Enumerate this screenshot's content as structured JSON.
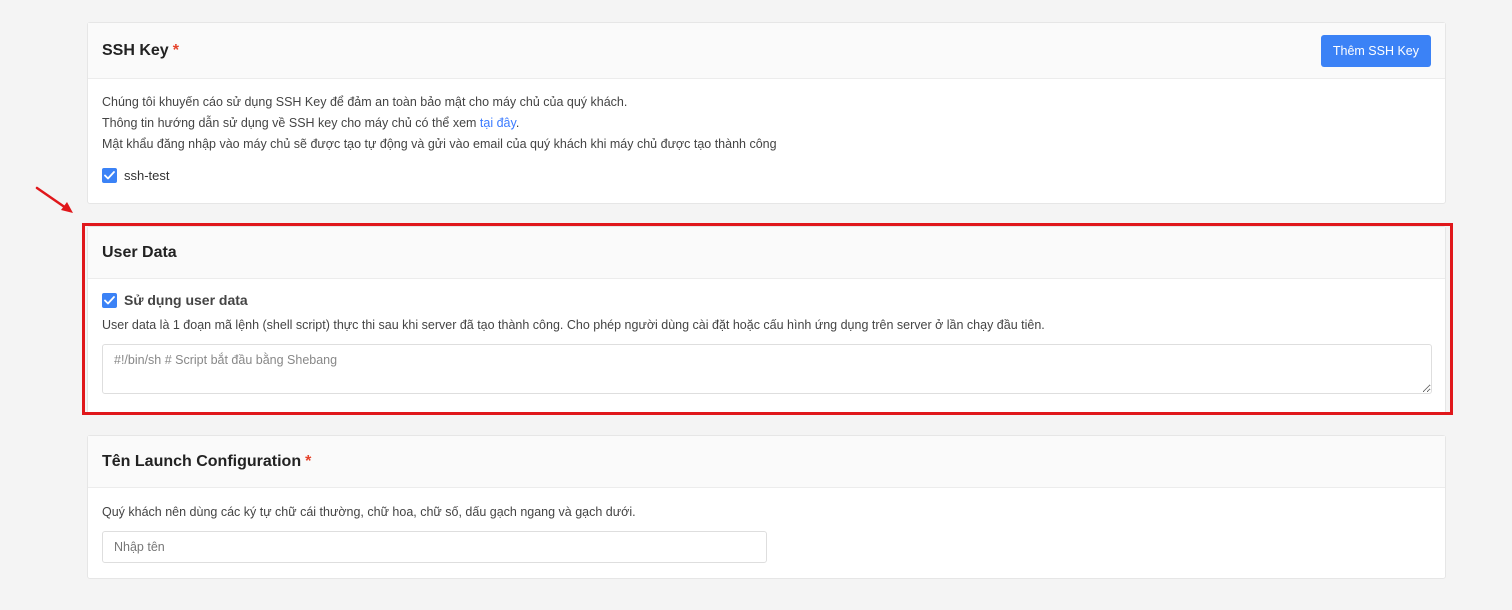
{
  "ssh_section": {
    "title": "SSH Key",
    "required_mark": "*",
    "add_button": "Thêm SSH Key",
    "line1": "Chúng tôi khuyến cáo sử dụng SSH Key để đảm an toàn bảo mật cho máy chủ của quý khách.",
    "line2_prefix": "Thông tin hướng dẫn sử dụng về SSH key cho máy chủ có thể xem ",
    "line2_link": "tại đây",
    "line2_suffix": ".",
    "line3": "Mật khẩu đăng nhập vào máy chủ sẽ được tạo tự động và gửi vào email của quý khách khi máy chủ được tạo thành công",
    "key_label": "ssh-test",
    "key_checked": true
  },
  "user_data_section": {
    "title": "User Data",
    "checkbox_label": "Sử dụng user data",
    "checkbox_checked": true,
    "description": "User data là 1 đoạn mã lệnh (shell script) thực thi sau khi server đã tạo thành công. Cho phép người dùng cài đặt hoặc cấu hình ứng dụng trên server ở lần chạy đầu tiên.",
    "textarea_placeholder": "#!/bin/sh # Script bắt đầu bằng Shebang",
    "textarea_value": ""
  },
  "launch_config_section": {
    "title": "Tên Launch Configuration",
    "required_mark": "*",
    "hint": "Quý khách nên dùng các ký tự chữ cái thường, chữ hoa, chữ số, dấu gạch ngang và gạch dưới.",
    "input_placeholder": "Nhập tên",
    "input_value": ""
  },
  "colors": {
    "accent": "#3b82f6",
    "required": "#e5432b",
    "highlight": "#e0171b",
    "link": "#3b7bff"
  }
}
